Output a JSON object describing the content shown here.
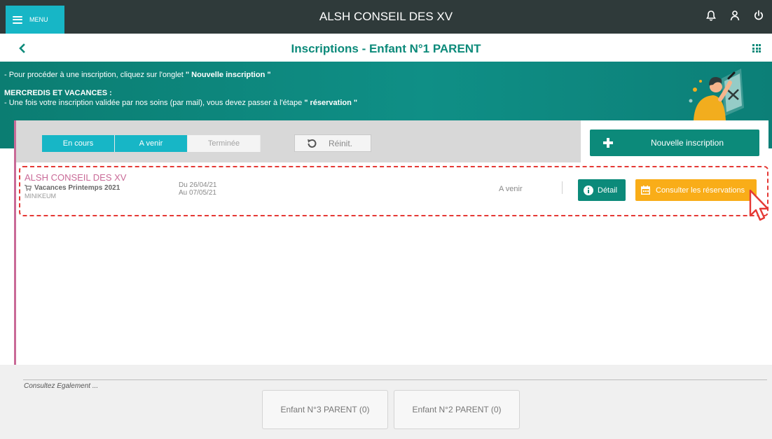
{
  "header": {
    "menu_label": "MENU",
    "app_title": "ALSH CONSEIL DES XV",
    "icons": [
      "bell-icon",
      "user-icon",
      "power-icon"
    ]
  },
  "subheader": {
    "title": "Inscriptions  -  Enfant N°1 PARENT"
  },
  "banner": {
    "line1_prefix": "- Pour procéder à une inscription, cliquez sur l'onglet ",
    "line1_bold": "\" Nouvelle inscription \"",
    "section_heading": "MERCREDIS ET VACANCES :",
    "line2_prefix": "- Une fois votre inscription validée par nos soins (par mail), vous devez passer à l'étape ",
    "line2_bold": "\" réservation \""
  },
  "toolbar": {
    "tabs": [
      {
        "label": "En cours",
        "state": "active"
      },
      {
        "label": "A venir",
        "state": "active"
      },
      {
        "label": "Terminée",
        "state": "inactive"
      }
    ],
    "reset_label": "Réinit.",
    "new_label": "Nouvelle inscription"
  },
  "inscriptions": [
    {
      "title": "ALSH CONSEIL DES XV",
      "period": "Vacances Printemps 2021",
      "center": "MINIKEUM",
      "date_from": "Du 26/04/21",
      "date_to": "Au 07/05/21",
      "status": "A venir",
      "detail_label": "Détail",
      "reservations_label": "Consulter les réservations"
    }
  ],
  "footer": {
    "see_also": "Consultez Egalement ...",
    "children": [
      {
        "label": "Enfant N°3 PARENT (0)"
      },
      {
        "label": "Enfant N°2 PARENT (0)"
      }
    ]
  },
  "colors": {
    "teal": "#0c8a7a",
    "cyan": "#17b6c6",
    "pink": "#c96a97",
    "orange": "#f9ad18",
    "topbar": "#2f3a3a"
  }
}
